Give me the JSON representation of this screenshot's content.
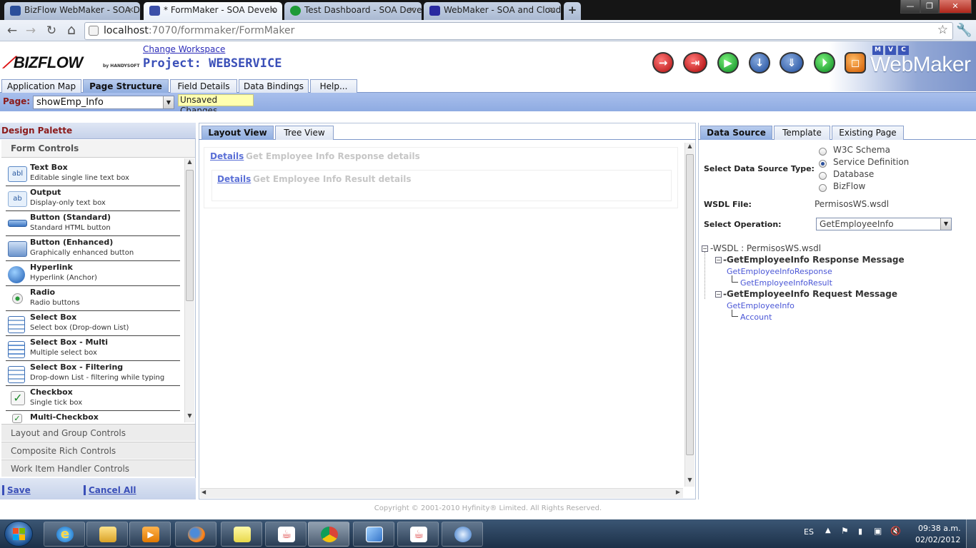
{
  "browser": {
    "tabs": [
      {
        "label": "BizFlow WebMaker - SOA D",
        "active": false
      },
      {
        "label": "* FormMaker - SOA Develo",
        "active": true
      },
      {
        "label": "Test Dashboard - SOA Deve",
        "active": false
      },
      {
        "label": "WebMaker - SOA and Cloud",
        "active": false
      }
    ],
    "url_host": "localhost",
    "url_path": ":7070/formmaker/FormMaker"
  },
  "app": {
    "logo": "BIZFLOW",
    "logo_sub": "by HANDYSOFT",
    "change_workspace": "Change Workspace",
    "project_title": "Project: WEBSERVICE",
    "brand_tags": [
      "M",
      "V",
      "C"
    ],
    "brand_name": "WebMaker",
    "tabs": [
      "Application Map",
      "Page Structure",
      "Field Details",
      "Data Bindings",
      "Help..."
    ],
    "active_tab": "Page Structure",
    "page_label": "Page:",
    "page_value": "showEmp_Info",
    "unsaved": "Unsaved Changes"
  },
  "palette": {
    "title": "Design Palette",
    "section": "Form Controls",
    "items": [
      {
        "title": "Text Box",
        "desc": "Editable single line text box"
      },
      {
        "title": "Output",
        "desc": "Display-only text box"
      },
      {
        "title": "Button (Standard)",
        "desc": "Standard HTML button"
      },
      {
        "title": "Button (Enhanced)",
        "desc": "Graphically enhanced button"
      },
      {
        "title": "Hyperlink",
        "desc": "Hyperlink (Anchor)"
      },
      {
        "title": "Radio",
        "desc": "Radio buttons"
      },
      {
        "title": "Select Box",
        "desc": "Select box (Drop-down List)"
      },
      {
        "title": "Select Box - Multi",
        "desc": "Multiple select box"
      },
      {
        "title": "Select Box - Filtering",
        "desc": "Drop-down List - filtering while typing"
      },
      {
        "title": "Checkbox",
        "desc": "Single tick box"
      },
      {
        "title": "Multi-Checkbox",
        "desc": ""
      }
    ],
    "groups": [
      "Layout and Group Controls",
      "Composite Rich Controls",
      "Work Item Handler Controls"
    ],
    "save": "Save",
    "cancel": "Cancel All"
  },
  "center": {
    "tabs": [
      "Layout View",
      "Tree View"
    ],
    "row1_link": "Details",
    "row1_text": "Get Employee Info Response details",
    "row2_link": "Details",
    "row2_text": "Get Employee Info Result details"
  },
  "right": {
    "tabs": [
      "Data Source",
      "Template",
      "Existing Page"
    ],
    "ds_type_label": "Select Data Source Type:",
    "ds_options": [
      "W3C Schema",
      "Service Definition",
      "Database",
      "BizFlow"
    ],
    "ds_selected": "Service Definition",
    "wsdl_label": "WSDL File:",
    "wsdl_value": "PermisosWS.wsdl",
    "op_label": "Select Operation:",
    "op_value": "GetEmployeeInfo",
    "tree": {
      "root": "WSDL : PermisosWS.wsdl",
      "response_msg": "GetEmployeeInfo Response Message",
      "response_el": "GetEmployeeInfoResponse",
      "response_child": "GetEmployeeInfoResult",
      "request_msg": "GetEmployeeInfo Request Message",
      "request_el": "GetEmployeeInfo",
      "request_child": "Account"
    }
  },
  "footer": {
    "copyright": "Copyright © 2001-2010 Hyfinity® Limited. All Rights Reserved."
  },
  "taskbar": {
    "lang": "ES",
    "time": "09:38 a.m.",
    "date": "02/02/2012"
  },
  "colors": {
    "accent": "#3a4fb8",
    "header_blue": "#8fabe2",
    "palette_title": "#8b1a1a"
  }
}
